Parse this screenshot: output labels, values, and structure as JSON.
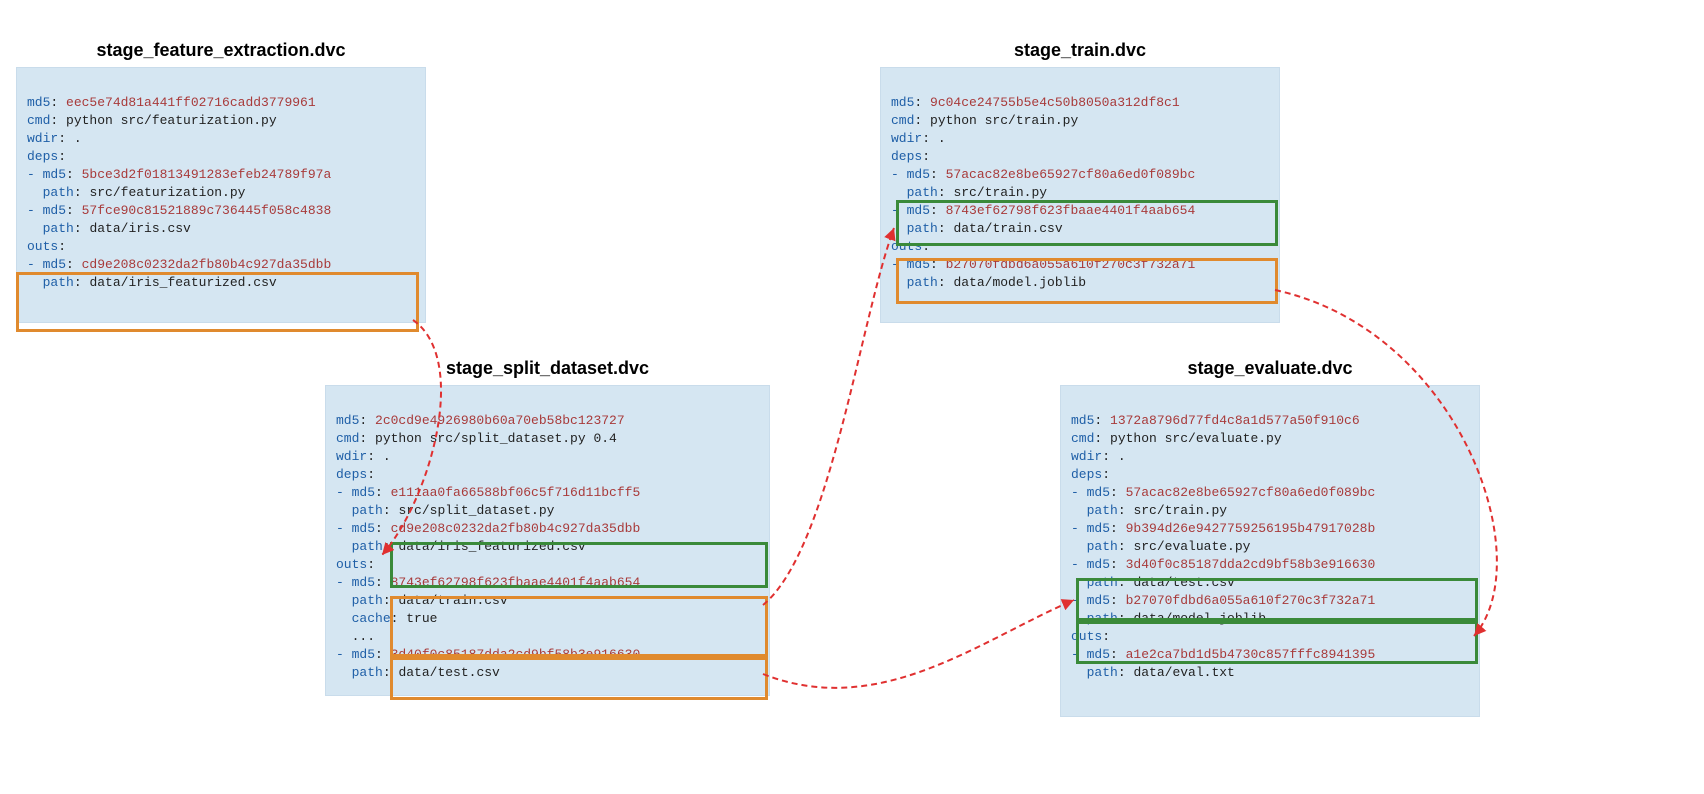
{
  "stages": {
    "feature_extraction": {
      "title": "stage_feature_extraction.dvc",
      "md5": "eec5e74d81a441ff02716cadd3779961",
      "cmd": "python src/featurization.py",
      "wdir": ".",
      "deps": [
        {
          "md5": "5bce3d2f01813491283efeb24789f97a",
          "path": "src/featurization.py"
        },
        {
          "md5": "57fce90c81521889c736445f058c4838",
          "path": "data/iris.csv"
        }
      ],
      "outs": [
        {
          "md5": "cd9e208c0232da2fb80b4c927da35dbb",
          "path": "data/iris_featurized.csv"
        }
      ]
    },
    "split_dataset": {
      "title": "stage_split_dataset.dvc",
      "md5": "2c0cd9e4926980b60a70eb58bc123727",
      "cmd": "python src/split_dataset.py 0.4",
      "wdir": ".",
      "deps": [
        {
          "md5": "e111aa0fa66588bf06c5f716d11bcff5",
          "path": "src/split_dataset.py"
        },
        {
          "md5": "cd9e208c0232da2fb80b4c927da35dbb",
          "path": "data/iris_featurized.csv"
        }
      ],
      "outs_a": {
        "md5": "8743ef62798f623fbaae4401f4aab654",
        "path": "data/train.csv",
        "cache": "true"
      },
      "ellipsis": "...",
      "outs_b": {
        "md5": "3d40f0c85187dda2cd9bf58b3e916630",
        "path": "data/test.csv"
      }
    },
    "train": {
      "title": "stage_train.dvc",
      "md5": "9c04ce24755b5e4c50b8050a312df8c1",
      "cmd": "python src/train.py",
      "wdir": ".",
      "deps": [
        {
          "md5": "57acac82e8be65927cf80a6ed0f089bc",
          "path": "src/train.py"
        },
        {
          "md5": "8743ef62798f623fbaae4401f4aab654",
          "path": "data/train.csv"
        }
      ],
      "outs": [
        {
          "md5": "b27070fdbd6a055a610f270c3f732a71",
          "path": "data/model.joblib"
        }
      ]
    },
    "evaluate": {
      "title": "stage_evaluate.dvc",
      "md5": "1372a8796d77fd4c8a1d577a50f910c6",
      "cmd": "python src/evaluate.py",
      "wdir": ".",
      "deps": [
        {
          "md5": "57acac82e8be65927cf80a6ed0f089bc",
          "path": "src/train.py"
        },
        {
          "md5": "9b394d26e9427759256195b47917028b",
          "path": "src/evaluate.py"
        },
        {
          "md5": "3d40f0c85187dda2cd9bf58b3e916630",
          "path": "data/test.csv"
        },
        {
          "md5": "b27070fdbd6a055a610f270c3f732a71",
          "path": "data/model.joblib"
        }
      ],
      "outs": [
        {
          "md5": "a1e2ca7bd1d5b4730c857fffc8941395",
          "path": "data/eval.txt"
        }
      ]
    }
  },
  "labels": {
    "md5": "md5",
    "cmd": "cmd",
    "wdir": "wdir",
    "deps": "deps",
    "outs": "outs",
    "path": "path",
    "cache": "cache"
  }
}
